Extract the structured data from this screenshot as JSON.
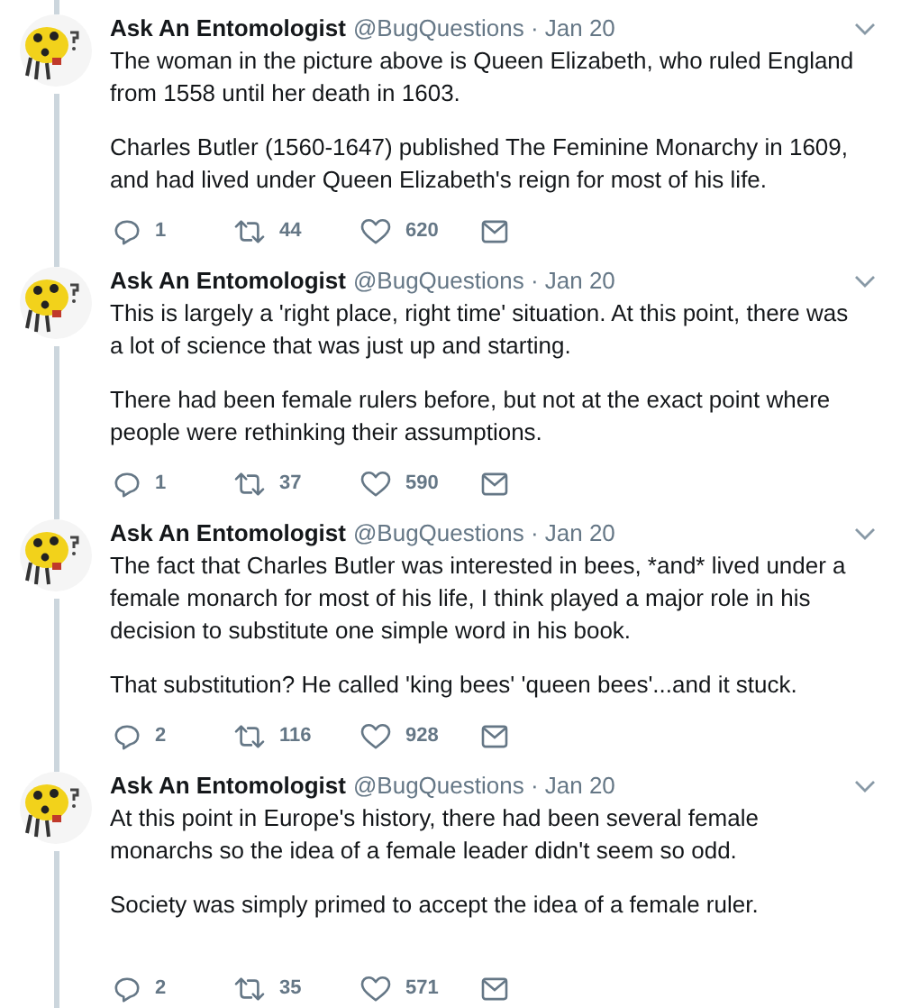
{
  "tweets": [
    {
      "author": "Ask An Entomologist",
      "meta": "@BugQuestions · Jan 20",
      "paragraphs": [
        "The woman in the picture above is Queen Elizabeth, who ruled England from 1558 until her death in 1603.",
        "Charles Butler (1560-1647) published The Feminine Monarchy in 1609, and had lived under Queen Elizabeth's reign for most of his life."
      ],
      "replies": "1",
      "retweets": "44",
      "likes": "620"
    },
    {
      "author": "Ask An Entomologist",
      "meta": "@BugQuestions · Jan 20",
      "paragraphs": [
        "This is largely a 'right place, right time' situation. At this point, there was a lot of science that was just up and starting.",
        "There had been female rulers before, but not at the exact point where people were rethinking their assumptions."
      ],
      "replies": "1",
      "retweets": "37",
      "likes": "590"
    },
    {
      "author": "Ask An Entomologist",
      "meta": "@BugQuestions · Jan 20",
      "paragraphs": [
        "The fact that Charles Butler was interested in bees, *and* lived under a female monarch for most of his life, I think played a major role in his decision to substitute one simple word in his book.",
        "That substitution? He called 'king bees' 'queen bees'...and it stuck."
      ],
      "replies": "2",
      "retweets": "116",
      "likes": "928"
    },
    {
      "author": "Ask An Entomologist",
      "meta": "@BugQuestions · Jan 20",
      "paragraphs": [
        "At this point in Europe's history, there had been several female monarchs so the idea of a female leader didn't seem so odd.",
        "Society was simply primed to accept the idea of a female ruler."
      ],
      "replies": "2",
      "retweets": "35",
      "likes": "571"
    }
  ]
}
